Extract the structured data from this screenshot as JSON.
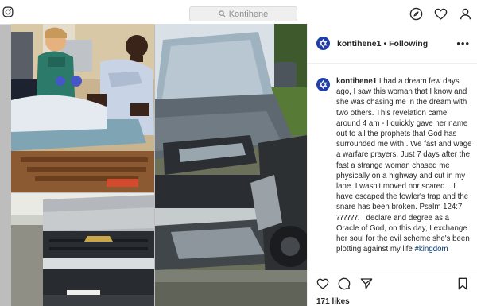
{
  "topbar": {
    "search_placeholder": "Kontihene",
    "icons": [
      "instagram-logo-icon",
      "search-icon",
      "compass-icon",
      "heart-icon",
      "profile-icon"
    ]
  },
  "post": {
    "images": [
      "hospital-bed-photo",
      "truck-grille-photo",
      "crashed-truck-photo"
    ],
    "header": {
      "username": "kontihene1",
      "separator": "•",
      "follow_label": "Following",
      "more_label": "•••"
    },
    "caption": {
      "username": "kontihene1",
      "text_before_hashtag": "I had a dream few days ago, I saw this woman that I know and she was chasing me in the dream with two others. This revelation came around 4 am - I quickly gave her name out to all the prophets that God has surrounded me with . We fast and wage a warfare prayers. Just 7 days after the fast a strange woman chased me physically on a highway and cut in my lane. I wasn't moved nor scared... I have escaped the fowler's trap and the snare has been broken. Psalm 124:7 ⁇⁇⁇. I declare and degree as a Oracle of God, on this day, I exchange her soul for the evil scheme she's been plotting against my life ",
      "hashtag": "#kingdom"
    },
    "likes": "171 likes",
    "colors": {
      "avatar_bg": "#1f3fa6",
      "hashtag": "#003569",
      "text": "#262626"
    }
  }
}
